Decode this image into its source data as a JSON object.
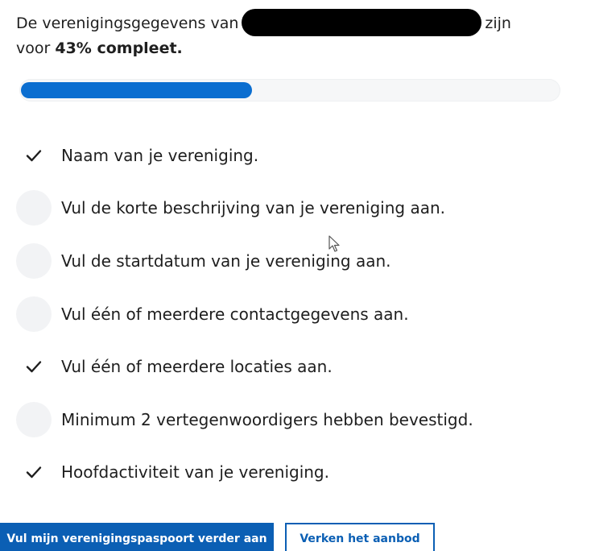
{
  "summary": {
    "prefix": "De verenigingsgegevens van",
    "suffix": "zijn",
    "line2_prefix": "voor",
    "percent_text": "43% compleet."
  },
  "progress": {
    "fraction": 0.43,
    "color": "#0b6ed0"
  },
  "checklist": [
    {
      "label": "Naam van je vereniging.",
      "done": true,
      "icon": "checkmark-icon"
    },
    {
      "label": "Vul de korte beschrijving van je vereniging aan.",
      "done": false,
      "icon": "empty-circle-icon"
    },
    {
      "label": "Vul de startdatum van je vereniging aan.",
      "done": false,
      "icon": "empty-circle-icon"
    },
    {
      "label": "Vul één of meerdere contactgegevens aan.",
      "done": false,
      "icon": "empty-circle-icon"
    },
    {
      "label": "Vul één of meerdere locaties aan.",
      "done": true,
      "icon": "checkmark-icon"
    },
    {
      "label": "Minimum 2 vertegenwoordigers hebben bevestigd.",
      "done": false,
      "icon": "empty-circle-icon"
    },
    {
      "label": "Hoofdactiviteit van je vereniging.",
      "done": true,
      "icon": "checkmark-icon"
    }
  ],
  "actions": {
    "primary_label": "Vul mijn verenigingspaspoort verder aan",
    "secondary_label": "Verken het aanbod",
    "accent_color": "#0b5fb4"
  }
}
